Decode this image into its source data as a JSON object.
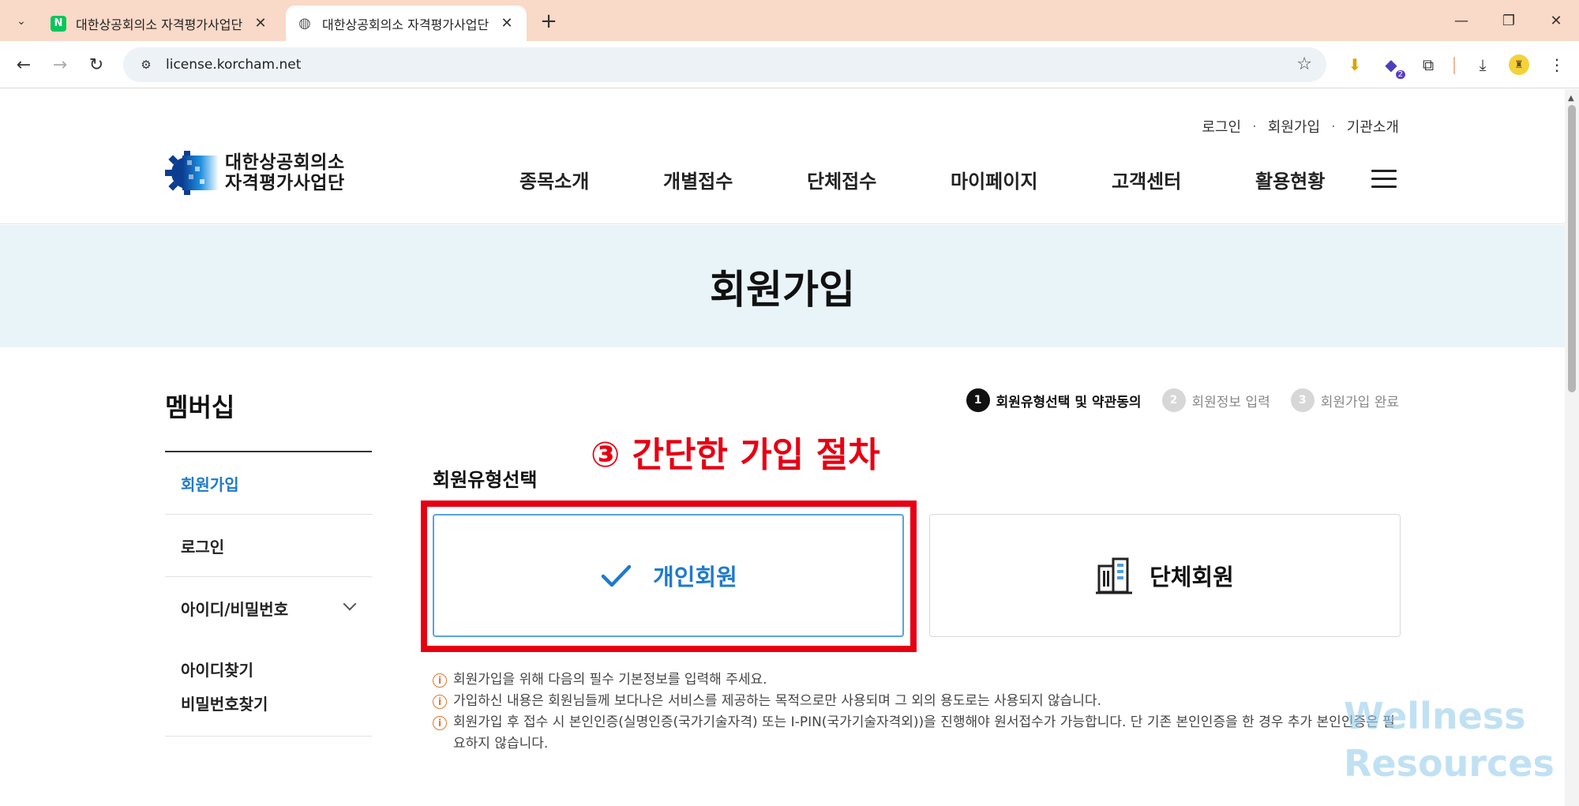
{
  "browser": {
    "tabs": [
      {
        "title": "대한상공회의소 자격평가사업단",
        "favicon": "naver-icon",
        "active": false
      },
      {
        "title": "대한상공회의소 자격평가사업단",
        "favicon": "globe-icon",
        "active": true
      }
    ],
    "url": "license.korcham.net",
    "extension_badge": "2",
    "accent_color": "#f9d9c7"
  },
  "header": {
    "util_links": [
      "로그인",
      "회원가입",
      "기관소개"
    ],
    "logo_line1": "대한상공회의소",
    "logo_line2": "자격평가사업단",
    "menu": [
      "종목소개",
      "개별접수",
      "단체접수",
      "마이페이지",
      "고객센터",
      "활용현황"
    ]
  },
  "hero": {
    "title": "회원가입"
  },
  "sidebar": {
    "title": "멤버십",
    "items": [
      "회원가입",
      "로그인",
      "아이디/비밀번호"
    ],
    "subitems": [
      "아이디찾기",
      "비밀번호찾기"
    ]
  },
  "steps": [
    {
      "num": "1",
      "label": "회원유형선택 및 약관동의"
    },
    {
      "num": "2",
      "label": "회원정보 입력"
    },
    {
      "num": "3",
      "label": "회원가입 완료"
    }
  ],
  "annotation": "③ 간단한 가입 절차",
  "member_type": {
    "title": "회원유형선택",
    "individual": "개인회원",
    "group": "단체회원"
  },
  "notes": [
    "회원가입을 위해 다음의 필수 기본정보를 입력해 주세요.",
    "가입하신 내용은 회원님들께 보다나은 서비스를 제공하는 목적으로만 사용되며 그 외의 용도로는 사용되지 않습니다.",
    "회원가입 후 접수 시 본인인증(실명인증(국가기술자격) 또는 I-PIN(국가기술자격외))을 진행해야 원서접수가 가능합니다. 단 기존 본인인증을 한 경우 추가 본인인증은 필요하지 않습니다."
  ],
  "watermark": {
    "line1": "Wellness",
    "line2": "Resources"
  },
  "colors": {
    "highlight": "#e60012",
    "selected": "#1f7acc",
    "hero_bg": "#e9f4f9"
  }
}
